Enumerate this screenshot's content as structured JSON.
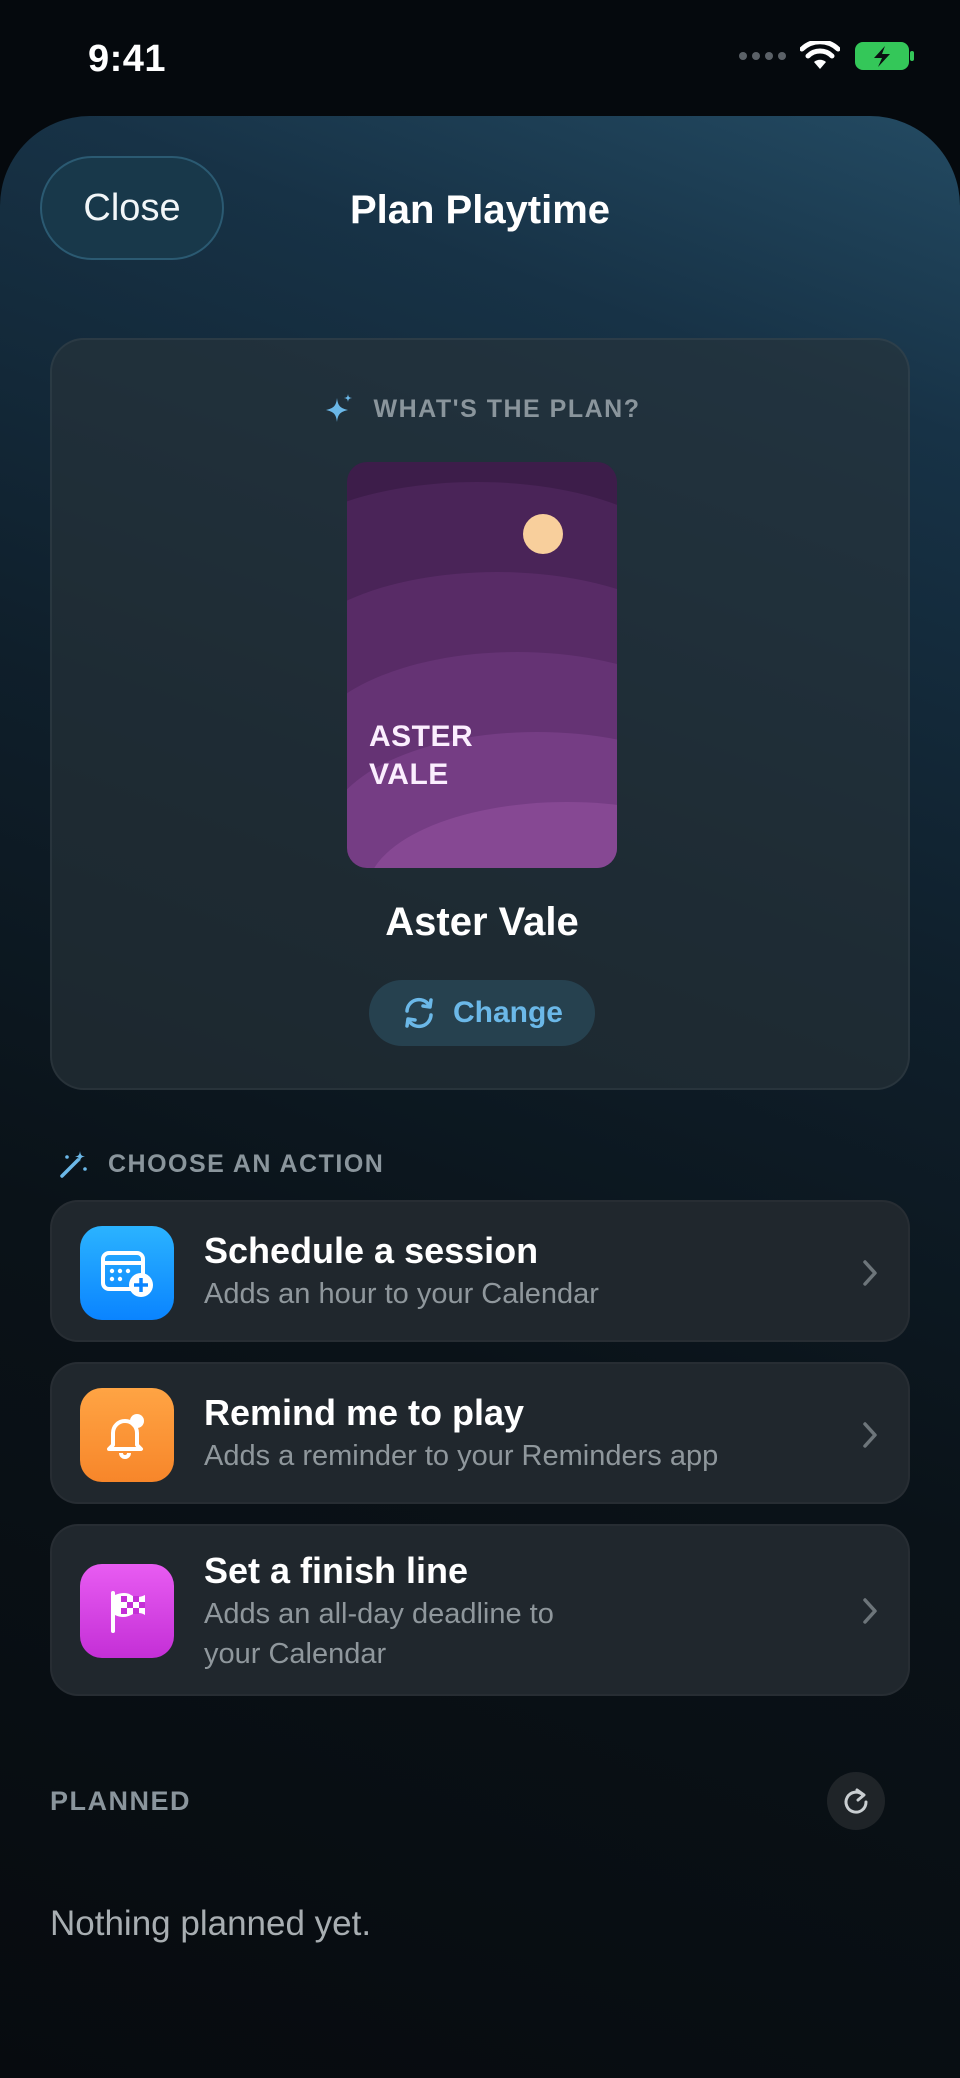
{
  "status_bar": {
    "time": "9:41",
    "icons": [
      "signal-icon",
      "wifi-icon",
      "battery-charging-icon"
    ]
  },
  "sheet": {
    "close_label": "Close",
    "title": "Plan Playtime"
  },
  "plan": {
    "header": "WHAT'S THE PLAN?",
    "header_icon": "sparkles-icon",
    "cover_title_line1": "ASTER",
    "cover_title_line2": "VALE",
    "game_name": "Aster Vale",
    "change_label": "Change",
    "change_icon": "refresh-arrows-icon"
  },
  "actions": {
    "header": "CHOOSE AN ACTION",
    "header_icon": "magic-wand-icon",
    "items": [
      {
        "title": "Schedule a session",
        "subtitle": "Adds an hour to your Calendar",
        "icon": "calendar-add-icon",
        "color": "#1e9bf5"
      },
      {
        "title": "Remind me to play",
        "subtitle": "Adds a reminder to your Reminders app",
        "icon": "bell-icon",
        "color": "#f7922e"
      },
      {
        "title": "Set a finish line",
        "subtitle_line1": "Adds an all-day deadline to",
        "subtitle_line2": "your Calendar",
        "icon": "checkered-flag-icon",
        "color": "#d33fe0"
      }
    ]
  },
  "planned": {
    "header": "PLANNED",
    "empty_text": "Nothing planned yet.",
    "refresh_icon": "refresh-icon"
  },
  "colors": {
    "accent": "#6bb8e8",
    "background": "#05090d",
    "card": "#20272d"
  }
}
